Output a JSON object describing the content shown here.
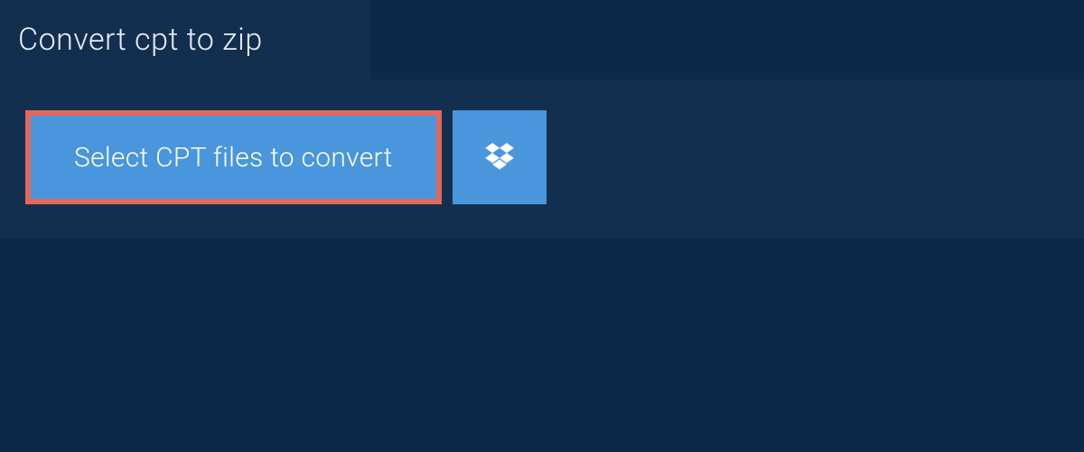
{
  "tab": {
    "title": "Convert cpt to zip"
  },
  "actions": {
    "select_files_label": "Select CPT files to convert"
  },
  "colors": {
    "background": "#0c2a47",
    "panel": "#132f4f",
    "accent": "#4a96dc",
    "highlight": "#e2685c",
    "text_light": "#e8edf2"
  }
}
